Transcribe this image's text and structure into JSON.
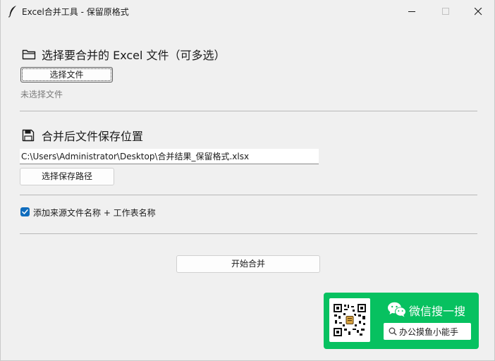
{
  "window": {
    "title": "Excel合并工具 - 保留原格式"
  },
  "section_select": {
    "title": "选择要合并的 Excel 文件（可多选）",
    "icon": "folder-icon",
    "button_label": "选择文件",
    "status": "未选择文件"
  },
  "section_save": {
    "title": "合并后文件保存位置",
    "icon": "floppy-disk-icon",
    "path_value": "C:\\Users\\Administrator\\Desktop\\合并结果_保留格式.xlsx",
    "button_label": "选择保存路径"
  },
  "options": {
    "add_source_label": "添加来源文件名称 + 工作表名称",
    "add_source_checked": true
  },
  "actions": {
    "start_label": "开始合并"
  },
  "wechat_card": {
    "title": "微信搜一搜",
    "search_text": "办公摸鱼小能手",
    "accent": "#07c160"
  },
  "colors": {
    "window_bg": "#f0f0f0",
    "checkbox_accent": "#0f6cbd"
  }
}
